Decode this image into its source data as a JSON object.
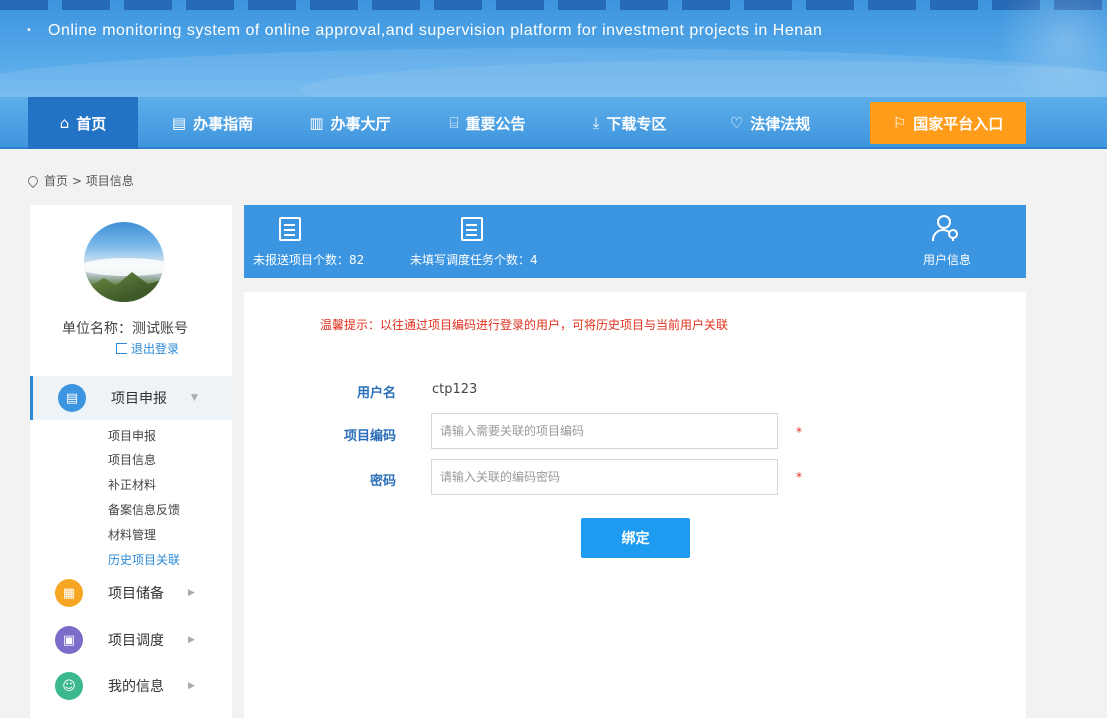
{
  "banner": {
    "subtitle": "Online monitoring system of online approval,and supervision platform for investment projects in Henan"
  },
  "nav": {
    "home": "首页",
    "guide": "办事指南",
    "hall": "办事大厅",
    "notice": "重要公告",
    "download": "下载专区",
    "law": "法律法规",
    "national": "国家平台入口"
  },
  "breadcrumb": {
    "home": "首页",
    "separator": " > ",
    "current": "项目信息"
  },
  "sidebar": {
    "unit_name": "单位名称：测试账号",
    "logout": "退出登录",
    "groups": [
      {
        "label": "项目申报",
        "color": "#3b95e0",
        "expanded": true
      },
      {
        "label": "项目储备",
        "color": "#f5a623",
        "expanded": false
      },
      {
        "label": "项目调度",
        "color": "#7b6cc9",
        "expanded": false
      },
      {
        "label": "我的信息",
        "color": "#3cb88e",
        "expanded": false
      }
    ],
    "sub_items": [
      "项目申报",
      "项目信息",
      "补正材料",
      "备案信息反馈",
      "材料管理",
      "历史项目关联"
    ]
  },
  "stats": {
    "unreported": "未报送项目个数：82",
    "tasks": "未填写调度任务个数：4",
    "user_info": "用户信息"
  },
  "form": {
    "notice": "温馨提示：以往通过项目编码进行登录的用户，可将历史项目与当前用户关联",
    "username_label": "用户名",
    "username_value": "ctp123",
    "code_label": "项目编码",
    "code_placeholder": "请输入需要关联的项目编码",
    "password_label": "密码",
    "password_placeholder": "请输入关联的编码密码",
    "required_mark": "*",
    "bind_button": "绑定"
  }
}
